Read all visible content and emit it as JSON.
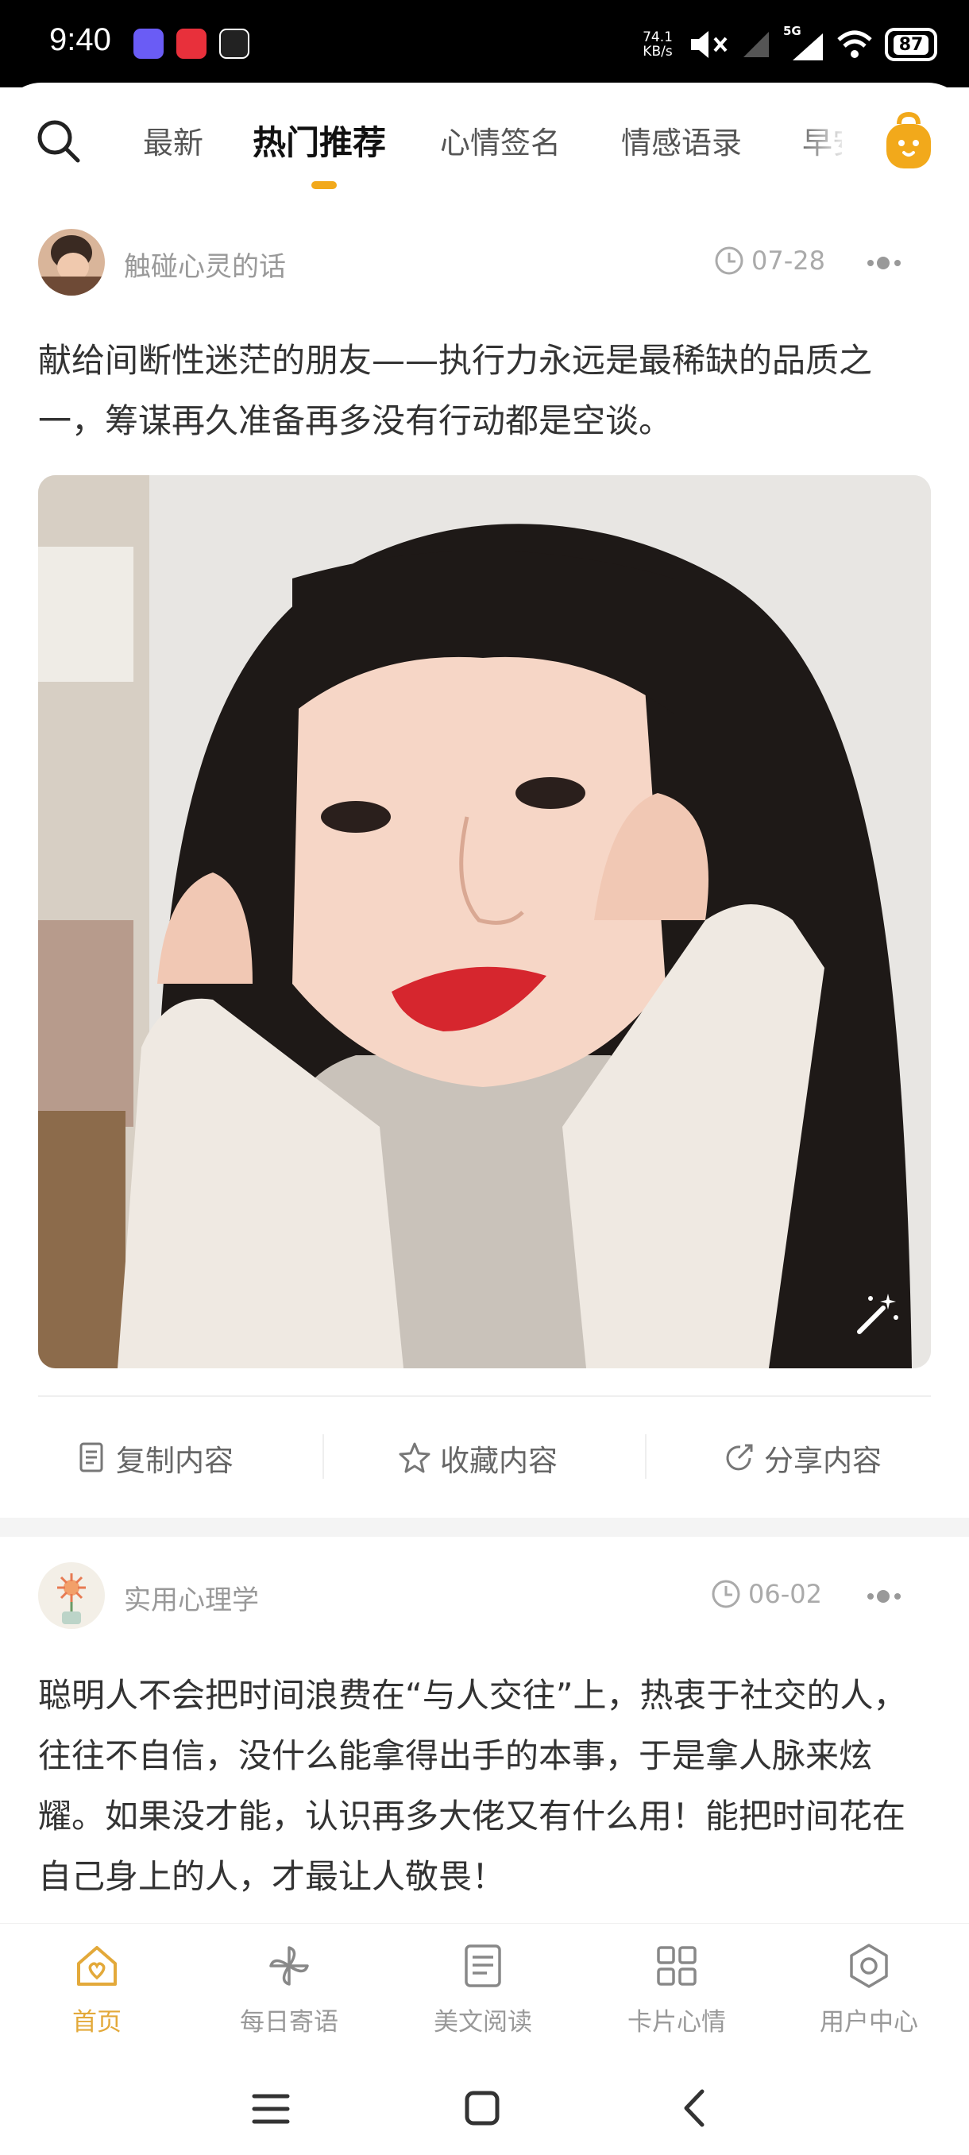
{
  "status_bar": {
    "time": "9:40",
    "net_speed_value": "74.1",
    "net_speed_unit": "KB/s",
    "signal_label": "5G",
    "battery": "87"
  },
  "tabs": [
    {
      "label": "最新",
      "active": false
    },
    {
      "label": "热门推荐",
      "active": true
    },
    {
      "label": "心情签名",
      "active": false
    },
    {
      "label": "情感语录",
      "active": false
    },
    {
      "label": "早安",
      "active": false
    }
  ],
  "posts": [
    {
      "author": "触碰心灵的话",
      "date": "07-28",
      "text": "献给间断性迷茫的朋友——执行力永远是最稀缺的品质之一，筹谋再久准备再多没有行动都是空谈。"
    },
    {
      "author": "实用心理学",
      "date": "06-02",
      "text": "聪明人不会把时间浪费在“与人交往”上，热衷于社交的人，往往不自信，没什么能拿得出手的本事，于是拿人脉来炫耀。如果没才能，认识再多大佬又有什么用！能把时间花在自己身上的人，才最让人敬畏！"
    }
  ],
  "actions": {
    "copy": "复制内容",
    "favorite": "收藏内容",
    "share": "分享内容"
  },
  "bottom_nav": [
    {
      "label": "首页",
      "icon": "home-icon",
      "active": true
    },
    {
      "label": "每日寄语",
      "icon": "pinwheel-icon",
      "active": false
    },
    {
      "label": "美文阅读",
      "icon": "document-icon",
      "active": false
    },
    {
      "label": "卡片心情",
      "icon": "grid-icon",
      "active": false
    },
    {
      "label": "用户中心",
      "icon": "settings-icon",
      "active": false
    }
  ],
  "colors": {
    "accent": "#f2a91b",
    "nav_active": "#e3a93a",
    "text_primary": "#333333",
    "text_muted": "#999999"
  }
}
